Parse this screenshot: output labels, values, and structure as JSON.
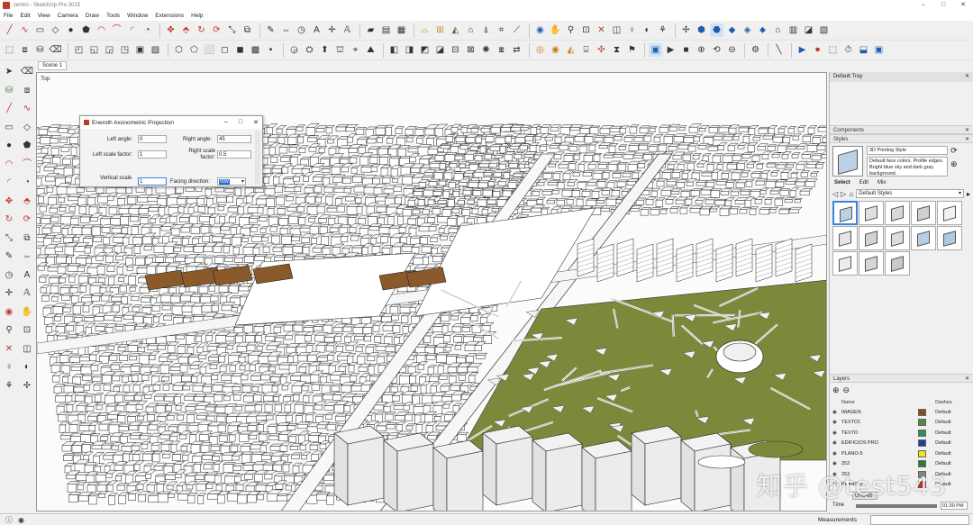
{
  "window": {
    "title": "centro - SketchUp Pro 2015",
    "controls": [
      "–",
      "□",
      "✕"
    ]
  },
  "menu": [
    "File",
    "Edit",
    "View",
    "Camera",
    "Draw",
    "Tools",
    "Window",
    "Extensions",
    "Help"
  ],
  "scene": {
    "tab_label": "Scene 1",
    "view_label": "Top"
  },
  "dialog": {
    "title": "Eneroth Axonometric Projection",
    "left_angle_label": "Left angle:",
    "left_angle_value": "0",
    "right_angle_label": "Right angle:",
    "right_angle_value": "45",
    "left_scale_label": "Left scale factor:",
    "left_scale_value": "1",
    "right_scale_label": "Right scale factor:",
    "right_scale_value": "0.5",
    "vertical_scale_label": "Vertical scale",
    "vertical_scale_value": "1",
    "facing_label": "Facing direction:",
    "facing_value": "NW"
  },
  "tray": {
    "title": "Default Tray",
    "components_label": "Components",
    "styles_label": "Styles",
    "style_name": "3D Printing Style",
    "style_description": "Default face colors. Profile edges. Bright blue sky and dark gray background.",
    "tabs": [
      "Select",
      "Edit",
      "Mix"
    ],
    "collection": "Default Styles",
    "layers_label": "Layers",
    "layers_col_name": "Name",
    "layers_col_dashes": "Dashes",
    "layers": [
      {
        "name": "IMAGEN",
        "color": "#8a4a1f",
        "dashes": "Default"
      },
      {
        "name": "TEXTO1",
        "color": "#4d8a3a",
        "dashes": "Default"
      },
      {
        "name": "TEXTO",
        "color": "#2e8f5a",
        "dashes": "Default"
      },
      {
        "name": "EDIFICIOS PRO",
        "color": "#1d3f9a",
        "dashes": "Default"
      },
      {
        "name": "PLANO-5",
        "color": "#f0e51c",
        "dashes": "Default"
      },
      {
        "name": "252",
        "color": "#2d7a3d",
        "dashes": "Default"
      },
      {
        "name": "253",
        "color": "#7c8a80",
        "dashes": "Default"
      },
      {
        "name": "PLANO-6",
        "color": "#d62b1f",
        "dashes": "Default"
      }
    ],
    "timezone": "UTC-60",
    "time_label": "Time",
    "time_value": "01:30 PM"
  },
  "status": {
    "measurements_label": "Measurements"
  },
  "watermark": "知乎 @test543",
  "colors": {
    "park": "#7a8a3a",
    "brown": "#8b5a2b"
  }
}
